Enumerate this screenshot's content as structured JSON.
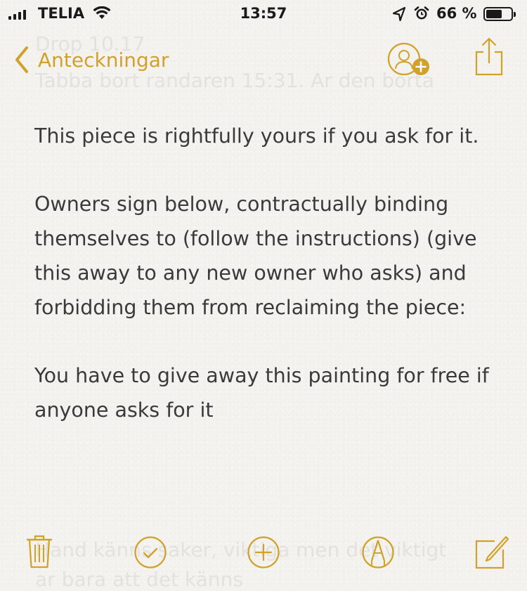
{
  "status_bar": {
    "carrier": "TELIA",
    "time": "13:57",
    "battery_percent": "66 %",
    "battery_level": 0.66
  },
  "nav": {
    "back_label": "Anteckningar"
  },
  "background_text": {
    "line1": "Drop 10.17",
    "line2": "Tabba bort randaren 15:31. Ar den borta",
    "line3": "Hand känns saker, viktiga men det viktigt",
    "line4": "ar bara att det känns"
  },
  "note": {
    "paragraphs": [
      "This piece is rightfully yours if you ask for it.",
      "Owners sign below, contractually binding themselves to (follow the instructions) (give this away to any new owner who asks) and forbidding them from reclaiming the piece:",
      "You have to give away this painting for free if anyone asks for it"
    ]
  },
  "icons": {
    "accent_color": "#d1a12a",
    "toolbar": [
      "trash-icon",
      "checklist-icon",
      "add-icon",
      "markup-pen-icon",
      "compose-icon"
    ]
  }
}
